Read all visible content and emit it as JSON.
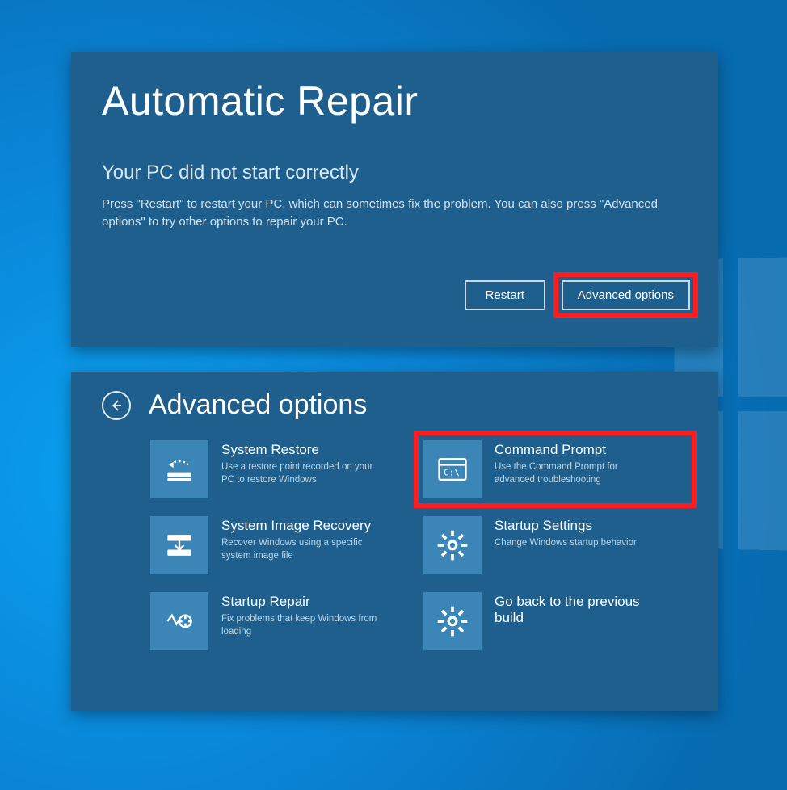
{
  "panel1": {
    "title": "Automatic Repair",
    "subtitle": "Your PC did not start correctly",
    "body": "Press \"Restart\" to restart your PC, which can sometimes fix the problem. You can also press \"Advanced options\" to try other options to repair your PC.",
    "restart_label": "Restart",
    "advanced_label": "Advanced options"
  },
  "panel2": {
    "title": "Advanced options",
    "options": [
      {
        "title": "System Restore",
        "desc": "Use a restore point recorded on your PC to restore Windows"
      },
      {
        "title": "Command Prompt",
        "desc": "Use the Command Prompt for advanced troubleshooting"
      },
      {
        "title": "System Image Recovery",
        "desc": "Recover Windows using a specific system image file"
      },
      {
        "title": "Startup Settings",
        "desc": "Change Windows startup behavior"
      },
      {
        "title": "Startup Repair",
        "desc": "Fix problems that keep Windows from loading"
      },
      {
        "title": "Go back to the previous build",
        "desc": ""
      }
    ]
  },
  "colors": {
    "panel_bg": "#1e5f8d",
    "tile_bg": "#3b86b7",
    "highlight": "#ff1c1c"
  }
}
